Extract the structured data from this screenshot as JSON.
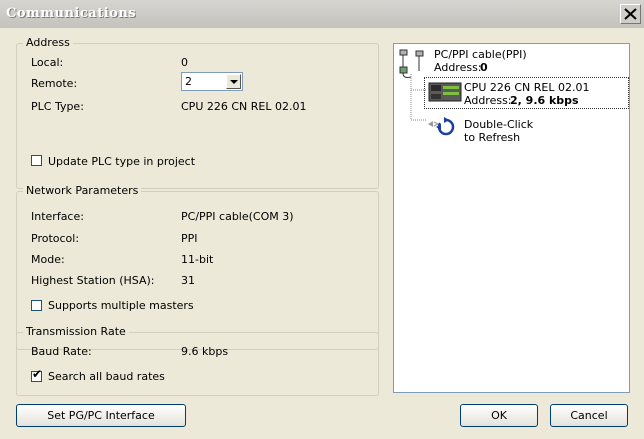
{
  "window": {
    "title": "Communications"
  },
  "address": {
    "legend": "Address",
    "local_label": "Local:",
    "local_value": "0",
    "remote_label": "Remote:",
    "remote_value": "2",
    "plc_type_label": "PLC Type:",
    "plc_type_value": "CPU 226 CN REL 02.01",
    "update_label": "Update PLC type in project",
    "update_checked": false
  },
  "network": {
    "legend": "Network Parameters",
    "interface_label": "Interface:",
    "interface_value": "PC/PPI cable(COM 3)",
    "protocol_label": "Protocol:",
    "protocol_value": "PPI",
    "mode_label": "Mode:",
    "mode_value": "11-bit",
    "hsa_label": "Highest Station (HSA):",
    "hsa_value": "31",
    "multi_label": "Supports multiple masters",
    "multi_checked": false
  },
  "transmission": {
    "legend": "Transmission Rate",
    "baud_label": "Baud Rate:",
    "baud_value": "9.6 kbps",
    "search_label": "Search all baud rates",
    "search_checked": true
  },
  "tree": {
    "cable_name": "PC/PPI cable(PPI)",
    "cable_address_label": "Address:",
    "cable_address_value": "0",
    "cpu_name": "CPU 226 CN REL 02.01",
    "cpu_address_label": "Address:",
    "cpu_address_value": "2, 9.6 kbps",
    "refresh_line1": "Double-Click",
    "refresh_line2": "to Refresh"
  },
  "buttons": {
    "set_interface": "Set PG/PC Interface",
    "ok": "OK",
    "cancel": "Cancel"
  }
}
